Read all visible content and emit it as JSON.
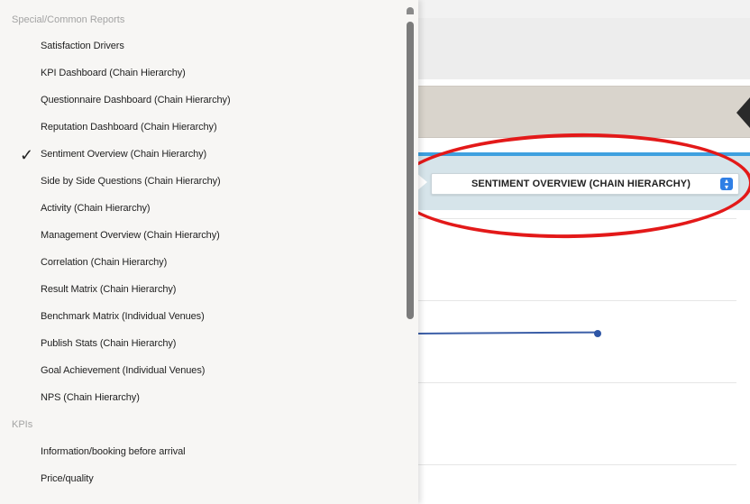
{
  "menu": {
    "groups": [
      {
        "header": "Special/Common Reports",
        "items": [
          {
            "label": "Satisfaction Drivers",
            "checked": false
          },
          {
            "label": "KPI Dashboard (Chain Hierarchy)",
            "checked": false
          },
          {
            "label": "Questionnaire Dashboard (Chain Hierarchy)",
            "checked": false
          },
          {
            "label": "Reputation Dashboard (Chain Hierarchy)",
            "checked": false
          },
          {
            "label": "Sentiment Overview (Chain Hierarchy)",
            "checked": true
          },
          {
            "label": "Side by Side Questions (Chain Hierarchy)",
            "checked": false
          },
          {
            "label": "Activity (Chain Hierarchy)",
            "checked": false
          },
          {
            "label": "Management Overview (Chain Hierarchy)",
            "checked": false
          },
          {
            "label": "Correlation (Chain Hierarchy)",
            "checked": false
          },
          {
            "label": "Result Matrix (Chain Hierarchy)",
            "checked": false
          },
          {
            "label": "Benchmark Matrix (Individual Venues)",
            "checked": false
          },
          {
            "label": "Publish Stats (Chain Hierarchy)",
            "checked": false
          },
          {
            "label": "Goal Achievement (Individual Venues)",
            "checked": false
          },
          {
            "label": "NPS (Chain Hierarchy)",
            "checked": false
          }
        ]
      },
      {
        "header": "KPIs",
        "items": [
          {
            "label": "Information/booking before arrival",
            "checked": false
          },
          {
            "label": "Price/quality",
            "checked": false
          }
        ]
      }
    ],
    "check_glyph": "✓"
  },
  "report_select": {
    "value": "SENTIMENT OVERVIEW (CHAIN HIERARCHY)",
    "stepper_glyph": "⇕"
  },
  "colors": {
    "accent_blue": "#3ea0df",
    "annotation_red": "#e31919",
    "series_line": "#3b5ea7"
  }
}
